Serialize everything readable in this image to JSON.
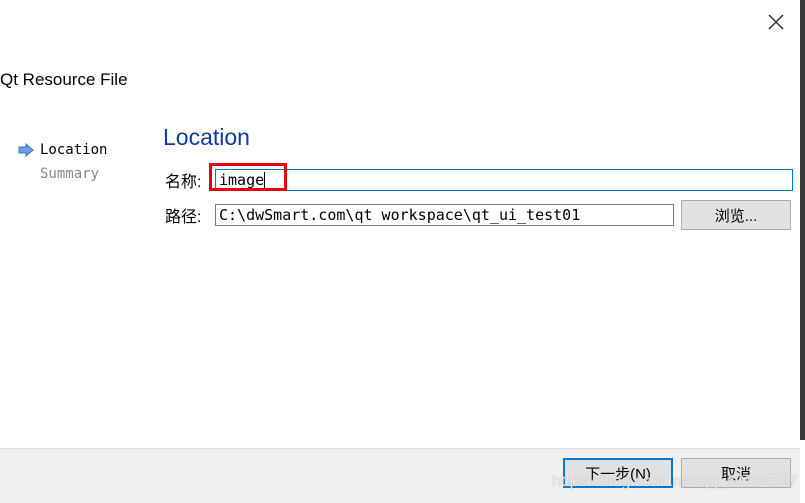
{
  "window": {
    "title": "Qt Resource File"
  },
  "steps": [
    {
      "label": "Location",
      "current": true
    },
    {
      "label": "Summary",
      "current": false
    }
  ],
  "page": {
    "heading": "Location"
  },
  "form": {
    "name_label": "名称:",
    "name_value": "image",
    "path_label": "路径:",
    "path_value": "C:\\dwSmart.com\\qt workspace\\qt_ui_test01",
    "browse_label": "浏览..."
  },
  "buttons": {
    "next": "下一步(N)",
    "cancel": "取消"
  },
  "watermark": "https://blog.csdn.net/qq_40104597",
  "colors": {
    "heading": "#0f3aa3",
    "highlight": "#e60012",
    "focus": "#0078d7"
  }
}
